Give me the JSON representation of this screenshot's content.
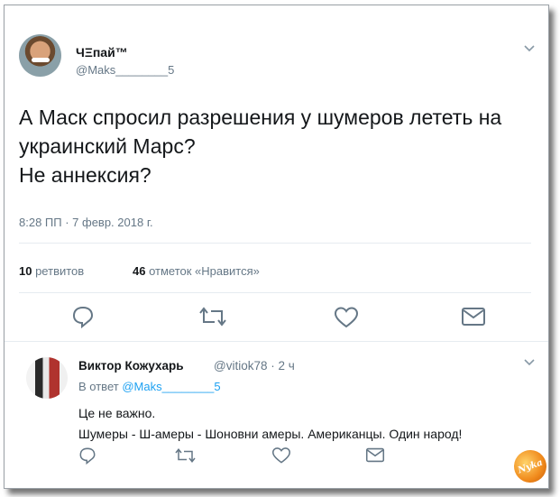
{
  "tweet": {
    "author_name": "ЧΞпай™",
    "author_handle": "@Maks________5",
    "text": "А Маск спросил разрешения у шумеров лететь на\nукраинский Марс?\nНе аннексия?",
    "timestamp": "8:28 ПП · 7 февр. 2018 г.",
    "retweets_count": "10",
    "retweets_label": " ретвитов",
    "likes_count": "46",
    "likes_label": " отметок «Нравится»"
  },
  "reply": {
    "author_name": "Виктор Кожухарь",
    "author_handle_time": "@vitiok78 · 2 ч",
    "reply_to_prefix": "В ответ ",
    "reply_to_handle": "@Maks________5",
    "text": "Це не важно.\nШумеры - Ш-амеры - Шоновни амеры. Американцы. Один народ!"
  },
  "watermark": {
    "text": "Nyka"
  },
  "icons": [
    "chevron-down-icon",
    "reply-icon",
    "retweet-icon",
    "like-icon",
    "message-icon"
  ]
}
